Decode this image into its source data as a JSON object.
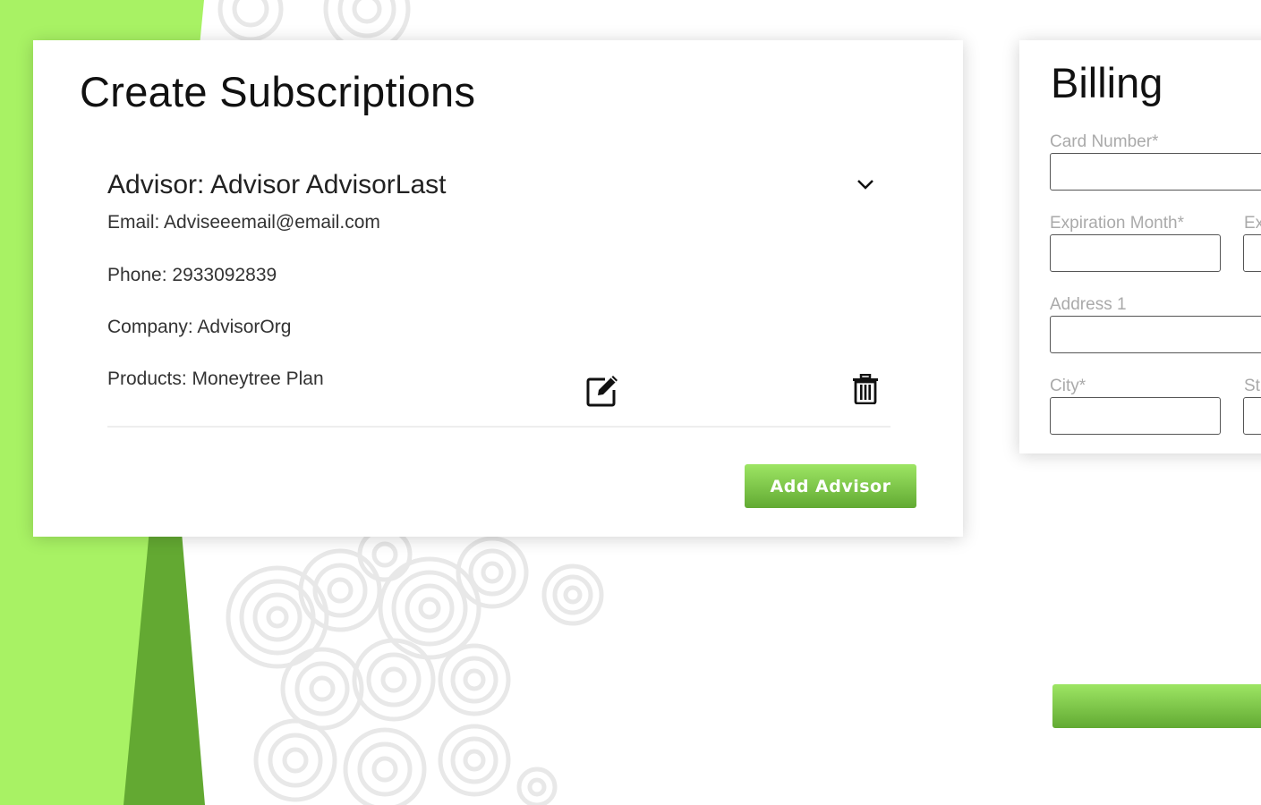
{
  "main": {
    "title": "Create Subscriptions",
    "advisor": {
      "header": "Advisor: Advisor AdvisorLast",
      "email": "Email: Adviseeemail@email.com",
      "phone": "Phone: 2933092839",
      "company": "Company: AdvisorOrg",
      "products": "Products: Moneytree Plan"
    },
    "add_advisor_label": "Add Advisor"
  },
  "billing": {
    "title": "Billing",
    "card_number_label": "Card Number*",
    "expiration_month_label": "Expiration Month*",
    "expiration_year_label_partial": "Ex",
    "address1_label": "Address 1",
    "city_label": "City*",
    "state_label_partial": "St"
  },
  "colors": {
    "accent_green": "#a8f264",
    "dark_green": "#63a932",
    "button_gradient_top": "#9de564",
    "button_gradient_bottom": "#62aa33"
  },
  "icons": {
    "chevron": "chevron-down-icon",
    "edit": "edit-icon",
    "trash": "trash-icon"
  }
}
